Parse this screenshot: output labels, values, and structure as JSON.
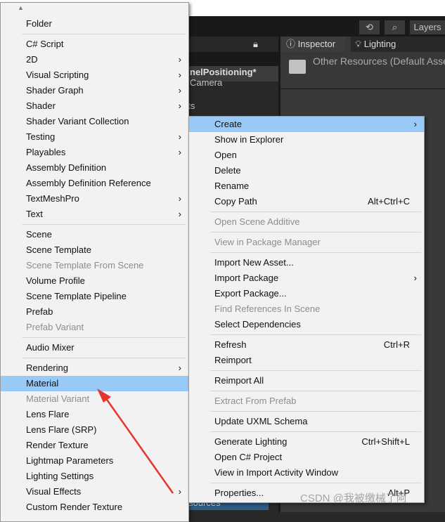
{
  "toolbar": {
    "layers_label": "Layers",
    "history_icon": "history-icon",
    "search_icon": "search-icon"
  },
  "hierarchy": {
    "scene_name": "nelPositioning*",
    "items": [
      "Camera",
      "ots"
    ],
    "selected_item": "sources"
  },
  "inspector": {
    "tabs": [
      "Inspector",
      "Lighting"
    ],
    "title": "Other Resources (Default Asse"
  },
  "left_menu": {
    "items": [
      {
        "label": "Folder"
      },
      {
        "sep": true
      },
      {
        "label": "C# Script"
      },
      {
        "label": "2D",
        "sub": true
      },
      {
        "label": "Visual Scripting",
        "sub": true
      },
      {
        "label": "Shader Graph",
        "sub": true
      },
      {
        "label": "Shader",
        "sub": true
      },
      {
        "label": "Shader Variant Collection"
      },
      {
        "label": "Testing",
        "sub": true
      },
      {
        "label": "Playables",
        "sub": true
      },
      {
        "label": "Assembly Definition"
      },
      {
        "label": "Assembly Definition Reference"
      },
      {
        "label": "TextMeshPro",
        "sub": true
      },
      {
        "label": "Text",
        "sub": true
      },
      {
        "sep": true
      },
      {
        "label": "Scene"
      },
      {
        "label": "Scene Template"
      },
      {
        "label": "Scene Template From Scene",
        "disabled": true
      },
      {
        "label": "Volume Profile"
      },
      {
        "label": "Scene Template Pipeline"
      },
      {
        "label": "Prefab"
      },
      {
        "label": "Prefab Variant",
        "disabled": true
      },
      {
        "sep": true
      },
      {
        "label": "Audio Mixer"
      },
      {
        "sep": true
      },
      {
        "label": "Rendering",
        "sub": true
      },
      {
        "label": "Material",
        "highlighted": true
      },
      {
        "label": "Material Variant",
        "disabled": true
      },
      {
        "label": "Lens Flare"
      },
      {
        "label": "Lens Flare (SRP)"
      },
      {
        "label": "Render Texture"
      },
      {
        "label": "Lightmap Parameters"
      },
      {
        "label": "Lighting Settings"
      },
      {
        "label": "Visual Effects",
        "sub": true
      },
      {
        "label": "Custom Render Texture"
      }
    ]
  },
  "right_menu": {
    "items": [
      {
        "label": "Create",
        "sub": true,
        "highlighted": true
      },
      {
        "label": "Show in Explorer"
      },
      {
        "label": "Open"
      },
      {
        "label": "Delete"
      },
      {
        "label": "Rename"
      },
      {
        "label": "Copy Path",
        "shortcut": "Alt+Ctrl+C"
      },
      {
        "sep": true
      },
      {
        "label": "Open Scene Additive",
        "disabled": true
      },
      {
        "sep": true
      },
      {
        "label": "View in Package Manager",
        "disabled": true
      },
      {
        "sep": true
      },
      {
        "label": "Import New Asset..."
      },
      {
        "label": "Import Package",
        "sub": true
      },
      {
        "label": "Export Package..."
      },
      {
        "label": "Find References In Scene",
        "disabled": true
      },
      {
        "label": "Select Dependencies"
      },
      {
        "sep": true
      },
      {
        "label": "Refresh",
        "shortcut": "Ctrl+R"
      },
      {
        "label": "Reimport"
      },
      {
        "sep": true
      },
      {
        "label": "Reimport All"
      },
      {
        "sep": true
      },
      {
        "label": "Extract From Prefab",
        "disabled": true
      },
      {
        "sep": true
      },
      {
        "label": "Update UXML Schema"
      },
      {
        "sep": true
      },
      {
        "label": "Generate Lighting",
        "shortcut": "Ctrl+Shift+L"
      },
      {
        "label": "Open C# Project"
      },
      {
        "label": "View in Import Activity Window"
      },
      {
        "sep": true
      },
      {
        "label": "Properties...",
        "shortcut": "Alt+P"
      }
    ]
  },
  "watermark": "CSDN @我被缴械了阿",
  "colors": {
    "highlight": "#99c9f7",
    "arrow": "#e8342c"
  }
}
